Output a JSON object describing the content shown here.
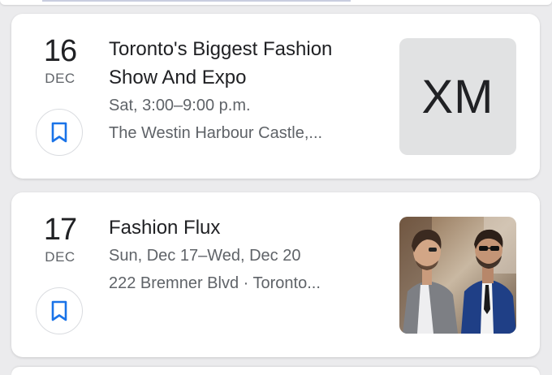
{
  "events": [
    {
      "day": "16",
      "month": "DEC",
      "title_line1": "Toronto's Biggest Fashion",
      "title_line2": "Show And Expo",
      "when": "Sat, 3:00–9:00 p.m.",
      "where": "The Westin Harbour Castle,...",
      "thumbnail_text": "XM",
      "bookmark_icon": "bookmark-icon"
    },
    {
      "day": "17",
      "month": "DEC",
      "title": "Fashion Flux",
      "when": "Sun, Dec 17–Wed, Dec 20",
      "where": "222 Bremner Blvd · Toronto...",
      "thumbnail_image": "two-men-in-suits-photo",
      "bookmark_icon": "bookmark-icon"
    }
  ],
  "colors": {
    "accent": "#1a73e8",
    "title_text": "#202124",
    "secondary_text": "#5f6368",
    "placeholder_bg": "#e1e2e3"
  }
}
